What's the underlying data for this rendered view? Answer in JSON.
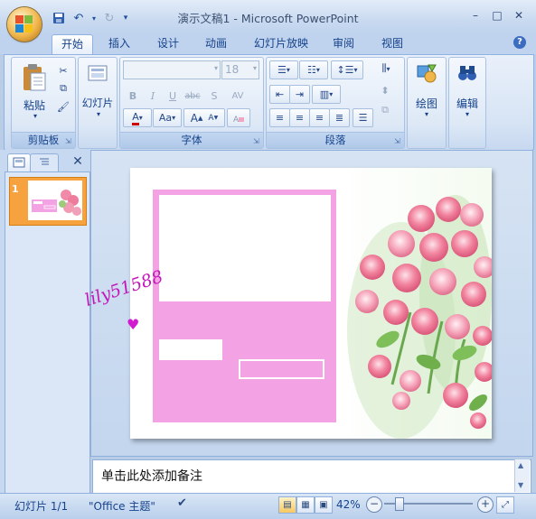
{
  "window": {
    "title": "演示文稿1 - Microsoft PowerPoint",
    "controls": {
      "minimize": "–",
      "maximize": "□",
      "close": "✕"
    }
  },
  "quick_access": {
    "save_icon": "save-icon",
    "undo_icon": "undo-icon",
    "redo_icon": "redo-icon"
  },
  "tabs": [
    {
      "label": "开始",
      "active": true
    },
    {
      "label": "插入"
    },
    {
      "label": "设计"
    },
    {
      "label": "动画"
    },
    {
      "label": "幻灯片放映"
    },
    {
      "label": "审阅"
    },
    {
      "label": "视图"
    }
  ],
  "ribbon": {
    "clipboard": {
      "label": "剪贴板",
      "paste": "粘贴"
    },
    "slides": {
      "new_slide": "幻灯片"
    },
    "font": {
      "label": "字体",
      "font_size": "18",
      "btn_bold": "B",
      "btn_italic": "I",
      "btn_underline": "U",
      "btn_strike": "abc",
      "btn_shadow": "S",
      "btn_spacing": "AV",
      "btn_color": "A",
      "btn_case": "Aa",
      "btn_grow": "A",
      "btn_shrink": "A"
    },
    "paragraph": {
      "label": "段落"
    },
    "drawing": {
      "label": "绘图"
    },
    "editing": {
      "label": "编辑"
    }
  },
  "slides_pane": {
    "tabs": [
      "slides-tab",
      "outline-tab"
    ],
    "close": "✕",
    "thumbnail_number": "1"
  },
  "slide": {
    "watermark": "lily51588"
  },
  "notes": {
    "placeholder": "单击此处添加备注"
  },
  "status_bar": {
    "slide_info": "幻灯片 1/1",
    "theme": "\"Office 主题\"",
    "zoom": "42%",
    "zoom_minus": "−",
    "zoom_plus": "+"
  }
}
